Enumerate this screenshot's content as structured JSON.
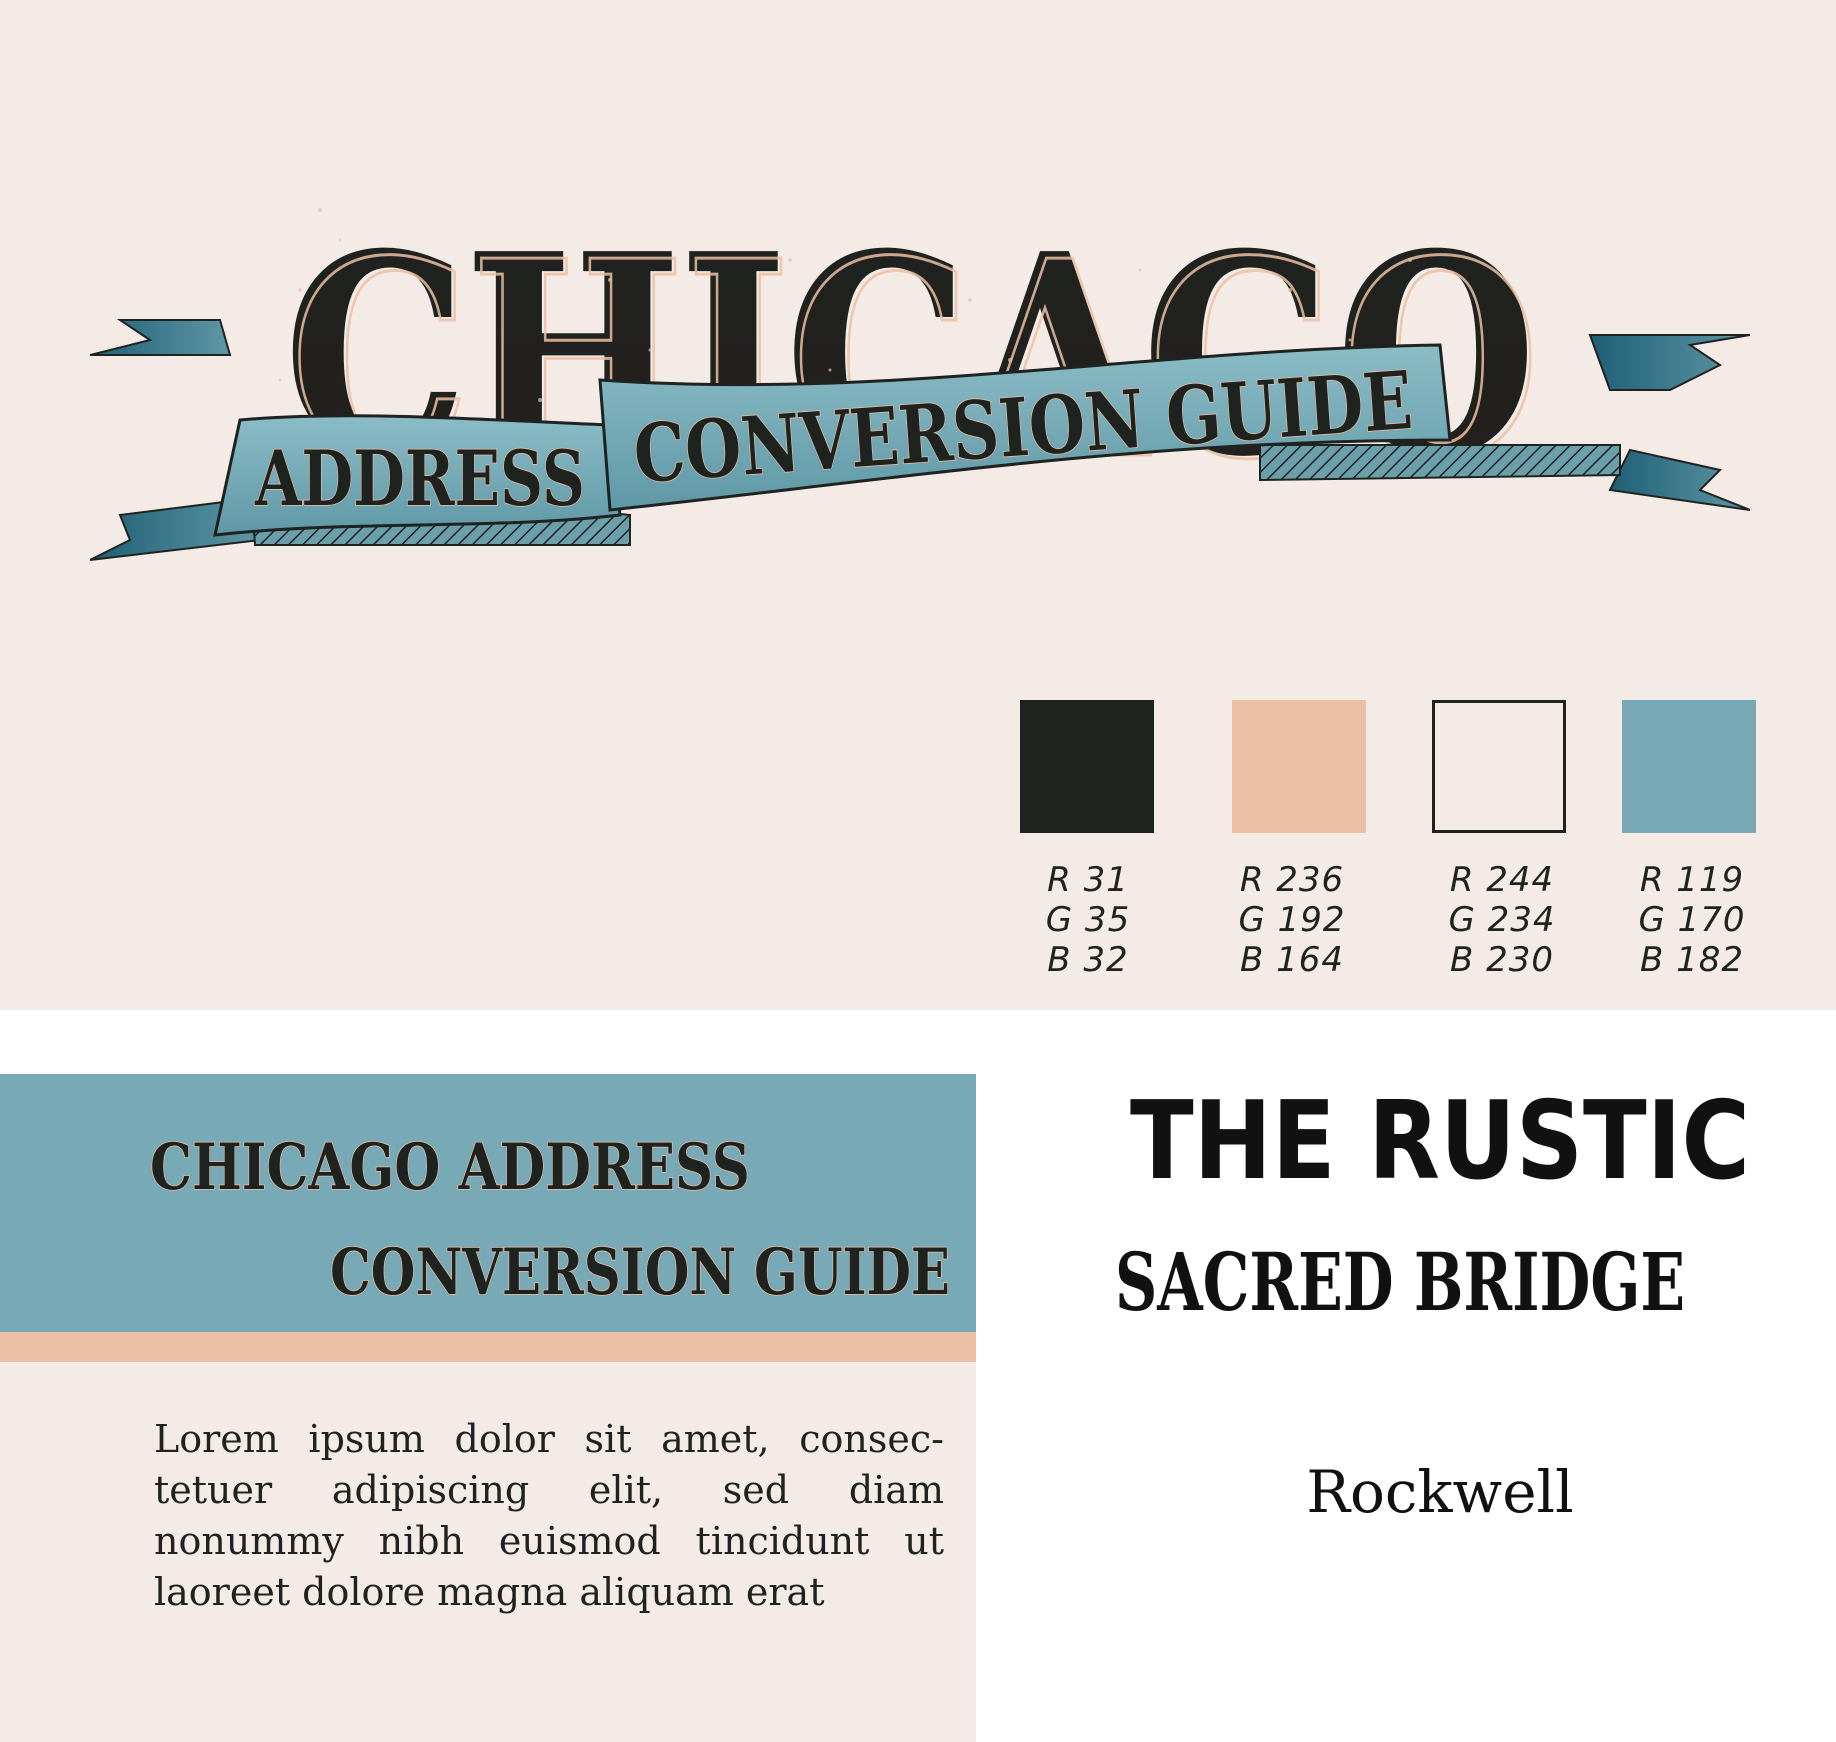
{
  "logo": {
    "title": "CHICAGO",
    "banner_left": "ADDRESS",
    "banner_right": "CONVERSION GUIDE"
  },
  "palette": [
    {
      "hex": "#1f2320",
      "r": "R 31",
      "g": "G 35",
      "b": "B 32"
    },
    {
      "hex": "#ecc0a4",
      "r": "R 236",
      "g": "G 192",
      "b": "B 164"
    },
    {
      "hex": "#f4eae6",
      "r": "R 244",
      "g": "G 234",
      "b": "B 230"
    },
    {
      "hex": "#77aab6",
      "r": "R 119",
      "g": "G 170",
      "b": "B 182"
    }
  ],
  "sample_card": {
    "title_line1": "CHICAGO ADDRESS",
    "title_line2": "CONVERSION GUIDE",
    "body": "Lorem ipsum dolor sit amet, consec-tetuer adipiscing elit, sed diam nonummy nibh euismod tincidunt ut laoreet dolore magna aliquam erat"
  },
  "fonts": {
    "primary": "THE RUSTIC",
    "secondary": "SACRED BRIDGE",
    "body": "Rockwell"
  }
}
